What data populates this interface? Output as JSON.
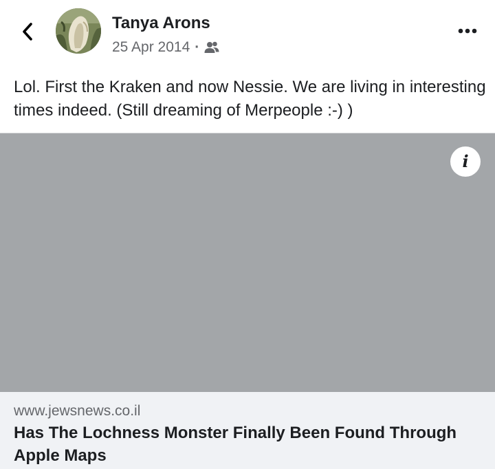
{
  "post": {
    "author_name": "Tanya Arons",
    "date": "25 Apr 2014",
    "separator": "·",
    "audience_icon": "friends-icon",
    "text": "Lol. First the Kraken and now Nessie.  We are living in interesting times indeed.  (Still dreaming of Merpeople :-) )"
  },
  "header": {
    "back_icon": "chevron-left-icon",
    "more_icon": "more-horizontal-icon"
  },
  "link_card": {
    "domain": "www.jewsnews.co.il",
    "title": "Has The Lochness Monster Finally Been Found Through Apple Maps",
    "info_label": "i",
    "image_color": "#a3a6a9"
  },
  "colors": {
    "text_primary": "#1c1e21",
    "text_secondary": "#65676b",
    "card_footer_bg": "#f0f2f5"
  }
}
